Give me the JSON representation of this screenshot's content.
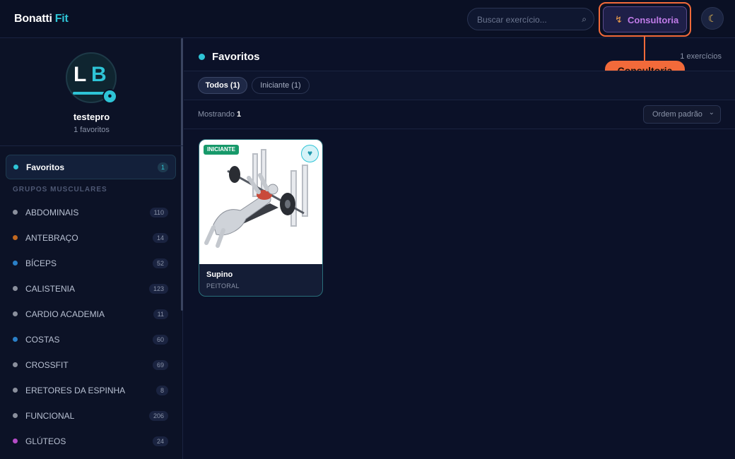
{
  "app": {
    "brand_main": "Bonatti",
    "brand_accent": "Fit"
  },
  "header": {
    "search_placeholder": "Buscar exercício...",
    "search_icon": "search-icon",
    "consult_label": "Consultoria",
    "consult_icon": "bolt-icon",
    "callout_label": "Consultoria",
    "theme_icon": "moon-icon"
  },
  "profile": {
    "initial_1": "L",
    "initial_2": "B",
    "username": "testepro",
    "favorites_count": "1 favoritos"
  },
  "sidebar": {
    "favorites": {
      "label": "Favoritos",
      "count": "1"
    },
    "group_header": "GRUPOS MUSCULARES",
    "groups": [
      {
        "label": "ABDOMINAIS",
        "count": "110",
        "color": "#8a8f9c"
      },
      {
        "label": "ANTEBRAÇO",
        "count": "14",
        "color": "#c2681f"
      },
      {
        "label": "BÍCEPS",
        "count": "52",
        "color": "#2a7fc7"
      },
      {
        "label": "CALISTENIA",
        "count": "123",
        "color": "#8a8f9c"
      },
      {
        "label": "CARDIO ACADEMIA",
        "count": "11",
        "color": "#8a8f9c"
      },
      {
        "label": "COSTAS",
        "count": "60",
        "color": "#2a7fc7"
      },
      {
        "label": "CROSSFIT",
        "count": "69",
        "color": "#8a8f9c"
      },
      {
        "label": "ERETORES DA ESPINHA",
        "count": "8",
        "color": "#8a8f9c"
      },
      {
        "label": "FUNCIONAL",
        "count": "206",
        "color": "#8a8f9c"
      },
      {
        "label": "GLÚTEOS",
        "count": "24",
        "color": "#b54cc7"
      }
    ]
  },
  "main": {
    "title": "Favoritos",
    "exercise_count": "1 exercícios",
    "filters": [
      {
        "label": "Todos (1)",
        "active": true
      },
      {
        "label": "Iniciante (1)",
        "active": false
      }
    ],
    "showing_label": "Mostrando",
    "showing_count": "1",
    "sort_label": "Ordem padrão",
    "cards": [
      {
        "level_badge": "INICIANTE",
        "name": "Supino",
        "group": "PEITORAL",
        "favorite": true
      }
    ]
  },
  "colors": {
    "accent": "#2ec4d6",
    "callout": "#f26a3a",
    "consult_text": "#c07be8",
    "badge_green": "#17996a"
  }
}
